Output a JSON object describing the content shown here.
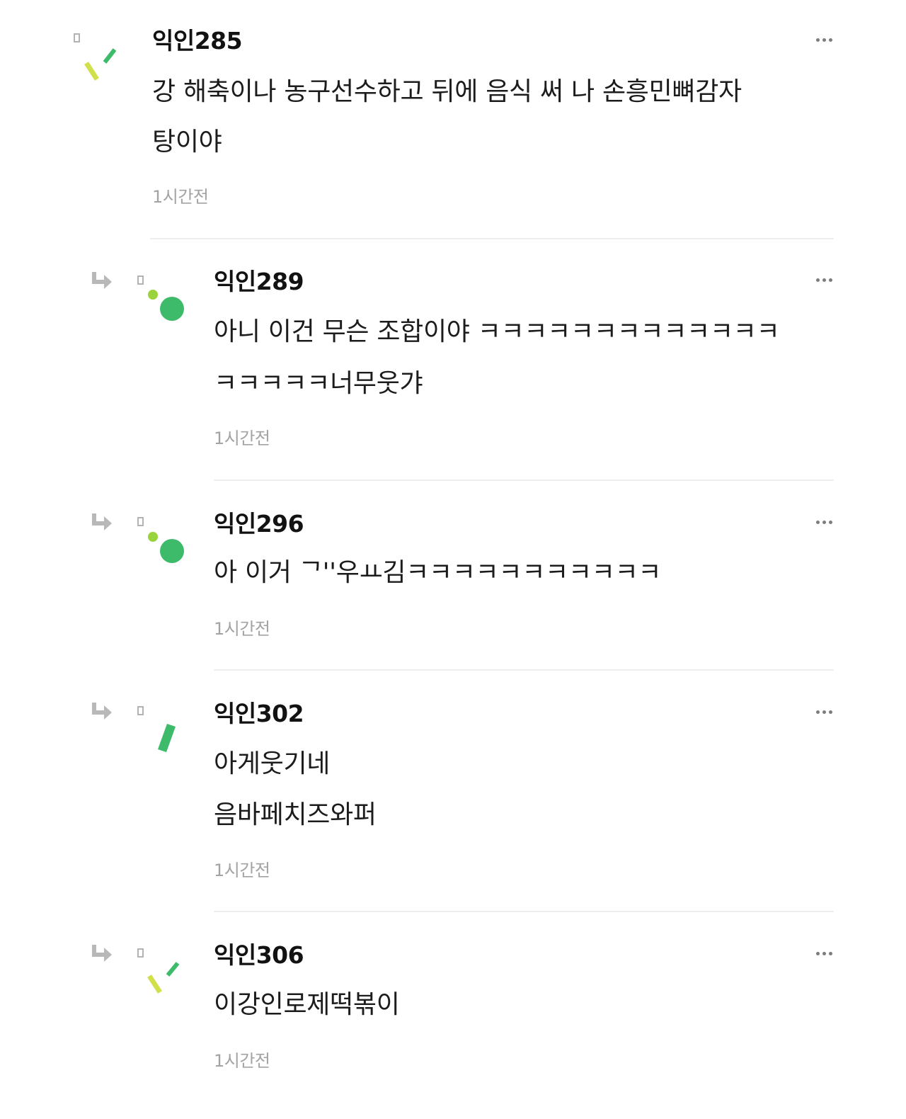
{
  "comments": [
    {
      "author": "익인285",
      "lines": [
        "강 해축이나 농구선수하고 뒤에 음식 써 나 손흥민뼈감자",
        "탕이야"
      ],
      "time": "1시간전",
      "is_reply": false,
      "avatar": "yellow-green-sticks-icon"
    },
    {
      "author": "익인289",
      "lines": [
        "아니 이건 무슨 조합이야 ㅋㅋㅋㅋㅋㅋㅋㅋㅋㅋㅋㅋㅋ",
        "ㅋㅋㅋㅋㅋ너무웃갸"
      ],
      "time": "1시간전",
      "is_reply": true,
      "avatar": "green-dots-icon"
    },
    {
      "author": "익인296",
      "lines": [
        "아 이거 ᄀ''우ㅛ김ㅋㅋㅋㅋㅋㅋㅋㅋㅋㅋㅋ"
      ],
      "time": "1시간전",
      "is_reply": true,
      "avatar": "green-dots-icon"
    },
    {
      "author": "익인302",
      "lines": [
        "아게웃기네",
        "음바페치즈와퍼"
      ],
      "time": "1시간전",
      "is_reply": true,
      "avatar": "green-bar-icon"
    },
    {
      "author": "익인306",
      "lines": [
        "이강인로제떡볶이"
      ],
      "time": "1시간전",
      "is_reply": true,
      "avatar": "yellow-green-sticks-icon"
    }
  ],
  "colors": {
    "avatar_green": "#3dbb6a",
    "avatar_lime": "#9ad43c",
    "avatar_yellow": "#cfe04a",
    "reply_arrow": "#b8b8b8",
    "timestamp": "#a3a3a3",
    "divider": "#eeeeee"
  }
}
